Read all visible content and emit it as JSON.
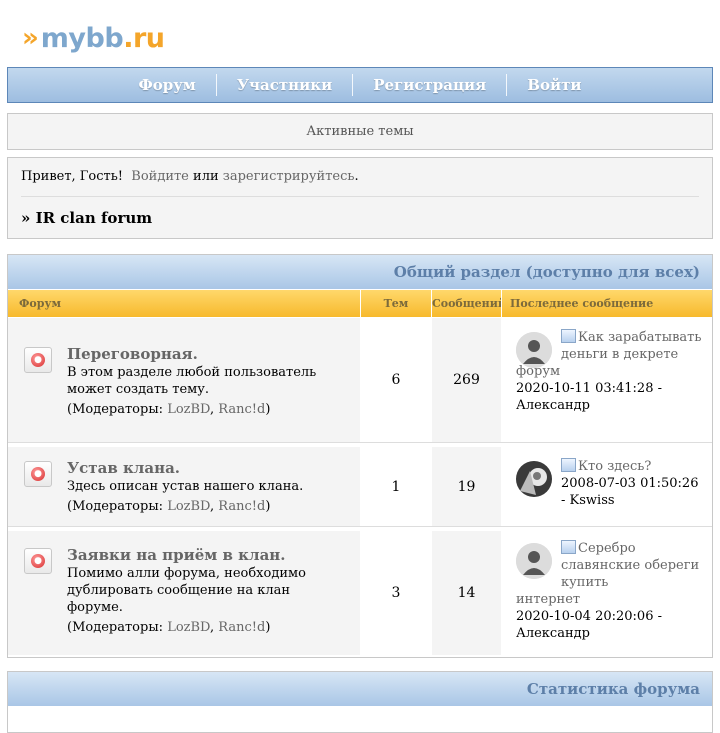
{
  "logo": {
    "chevrons": "»",
    "name": "mybb",
    "tld": ".ru"
  },
  "nav": {
    "items": [
      "Форум",
      "Участники",
      "Регистрация",
      "Войти"
    ]
  },
  "active_topics": "Активные темы",
  "greeting": {
    "hello": "Привет, Гость!",
    "login": "Войдите",
    "or": "или",
    "register": "зарегистрируйтесь",
    "period": ".",
    "breadcrumb": "» IR clan forum"
  },
  "category": {
    "title": "Общий раздел (доступно для всех)",
    "columns": {
      "forum": "Форум",
      "topics": "Тем",
      "posts": "Сообщений",
      "last": "Последнее сообщение"
    },
    "forums": [
      {
        "name": "Переговорная.",
        "description": "В этом разделе любой пользователь может создать тему.",
        "mods_label": "(Модераторы:",
        "mod1": "LozBD",
        "comma": ",",
        "mod2": "Ranc!d",
        "mods_close": ")",
        "topics": "6",
        "posts": "269",
        "last_title": "Как зарабатывать деньги в декрете",
        "last_cont": "форум",
        "last_meta": "2020-10-11 03:41:28 - Александр"
      },
      {
        "name": "Устав клана.",
        "description": "Здесь описан устав нашего клана.",
        "mods_label": "(Модераторы:",
        "mod1": "LozBD",
        "comma": ",",
        "mod2": "Ranc!d",
        "mods_close": ")",
        "topics": "1",
        "posts": "19",
        "last_title": "Кто здесь?",
        "last_cont": "",
        "last_meta": "2008-07-03 01:50:26 - Kswiss"
      },
      {
        "name": "Заявки на приём в клан.",
        "description": "Помимо алли форума, необходимо дублировать сообщение на клан форуме.",
        "mods_label": "(Модераторы:",
        "mod1": "LozBD",
        "comma": ",",
        "mod2": "Ranc!d",
        "mods_close": ")",
        "topics": "3",
        "posts": "14",
        "last_title": "Серебро славянские обереги купить",
        "last_cont": "интернет",
        "last_meta": "2020-10-04 20:20:06 - Александр"
      }
    ]
  },
  "stats": {
    "title": "Статистика форума"
  },
  "colors": {
    "nav_blue": "#9dbde0",
    "header_text": "#5d7fa8",
    "column_yellow": "#f7b92c",
    "link_gray": "#666666",
    "logo_orange": "#f4a52a",
    "logo_blue": "#7ea7cd"
  }
}
